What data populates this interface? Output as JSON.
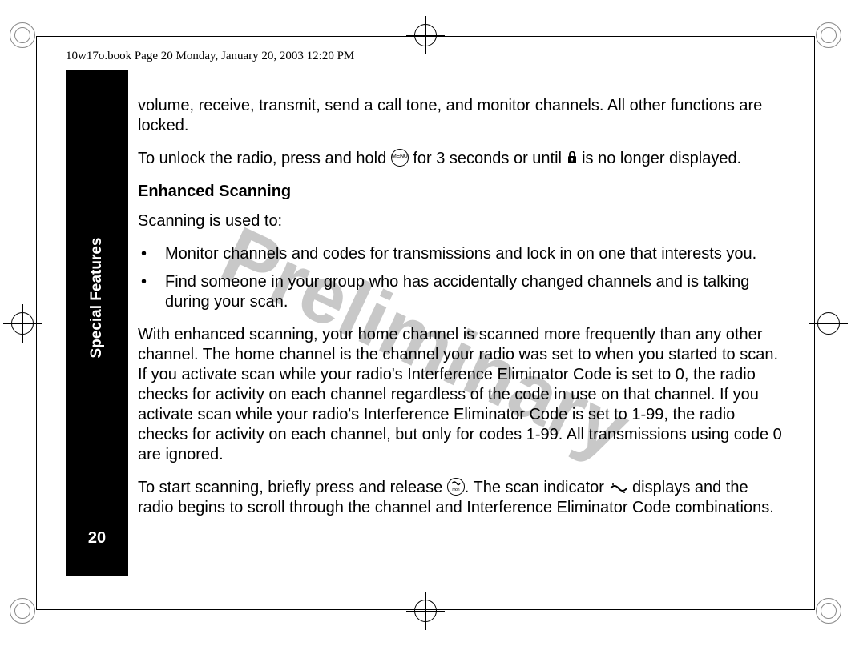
{
  "running_head": "10w17o.book  Page 20  Monday, January 20, 2003  12:20 PM",
  "sidebar": {
    "title": "Special Features",
    "page_number": "20"
  },
  "watermark": "Preliminary",
  "content": {
    "para1": "volume, receive, transmit, send a call tone, and monitor channels. All other functions are locked.",
    "para2_a": "To unlock the radio, press and hold ",
    "para2_b": " for 3 seconds or until ",
    "para2_c": " is no longer displayed.",
    "heading": "Enhanced Scanning",
    "para3": "Scanning is used to:",
    "bullets": [
      "Monitor channels and codes for transmissions and lock in on one that interests you.",
      "Find someone in your group who has accidentally changed channels and is talking during your scan."
    ],
    "para4": "With enhanced scanning, your home channel is scanned more frequently than any other channel. The home channel is the channel your radio was set to when you started to scan. If you activate scan while your radio's Interference Eliminator Code is set to 0, the radio checks for activity on each channel regardless of the code in use on that channel. If you activate scan while your radio's Interference Eliminator Code is set to 1-99, the radio checks for activity on each channel, but only for codes 1-99. All transmissions using code 0 are ignored.",
    "para5_a": "To start scanning, briefly press and release ",
    "para5_b": ". The scan indicator ",
    "para5_c": " displays and the radio begins to scroll through the channel and Interference Eliminator Code combinations."
  },
  "icons": {
    "menu_label": "MENU",
    "mon_label": "mon"
  }
}
